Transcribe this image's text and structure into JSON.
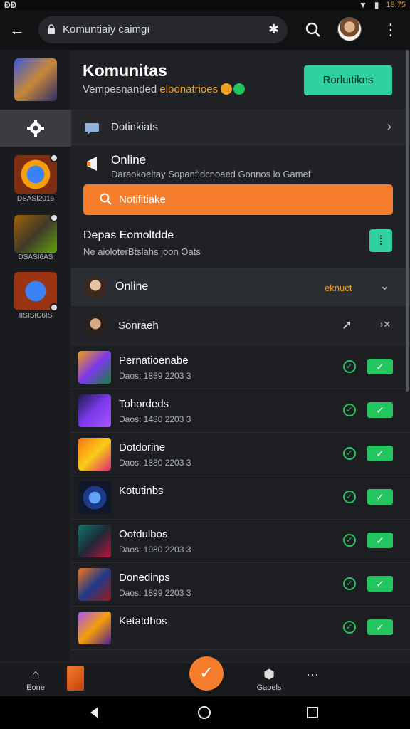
{
  "status_bar": {
    "left": "ÐÐ",
    "time": "18:75"
  },
  "topbar": {
    "url": "Komuntiaiy caimgı"
  },
  "sidebar": {
    "items": [
      {
        "label": "DSASI2016"
      },
      {
        "label": "DSASI6AS"
      },
      {
        "label": "IISISIC6IS"
      }
    ]
  },
  "header": {
    "title": "Komunitas",
    "subtitle_prefix": "Vempesnanded ",
    "subtitle_accent": "eloonatrioes",
    "join_label": "Rorluıtikns"
  },
  "discussions": {
    "label": "Dotinkiats"
  },
  "online_section": {
    "label": "Online",
    "description": "Daraokoeltay Sopanf:dcnoaed Gonnos lo Gamef",
    "notify_label": "Notifitiake"
  },
  "updates_section": {
    "label": "Depas Eomoltdde",
    "description": "Ne aioloterBtslahs joon Oats",
    "toggle": "⁞"
  },
  "online_row": {
    "label": "Online",
    "meta": "eknuct"
  },
  "search_row": {
    "label": "Sonraeh"
  },
  "list": [
    {
      "name": "Pernatioenabe",
      "date": "Daos: 1859 2203 3"
    },
    {
      "name": "Tohordeds",
      "date": "Daos: 1480 2203 3"
    },
    {
      "name": "Dotdorine",
      "date": "Daos: 1880 2203 3"
    },
    {
      "name": "Kotutinbs",
      "date": ""
    },
    {
      "name": "Ootdulbos",
      "date": "Daos: 1980 2203 3"
    },
    {
      "name": "Donedinps",
      "date": "Daos: 1899 2203 3"
    },
    {
      "name": "Ketatdhos",
      "date": ""
    }
  ],
  "bottom_nav": {
    "home_label": "Eone",
    "games_label": "Gaoels",
    "more_label": "···"
  },
  "colors": {
    "accent_orange": "#f57c2a",
    "accent_teal": "#2fd1a0",
    "accent_green": "#22c55e",
    "background": "#1d1f22"
  }
}
